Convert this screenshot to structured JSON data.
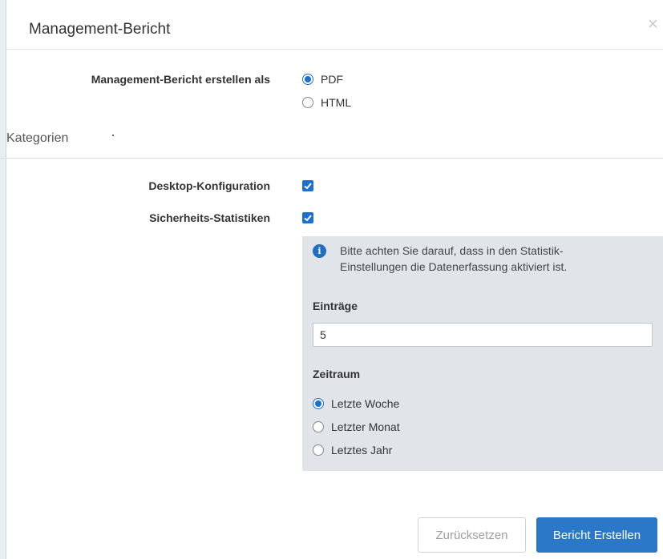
{
  "dialog": {
    "title": "Management-Bericht",
    "close_glyph": "×"
  },
  "format": {
    "label": "Management-Bericht erstellen als",
    "options": [
      {
        "label": "PDF",
        "checked": true
      },
      {
        "label": "HTML",
        "checked": false
      }
    ]
  },
  "categories": {
    "title": "Kategorien",
    "items": [
      {
        "label": "Desktop-Konfiguration",
        "checked": true
      },
      {
        "label": "Sicherheits-Statistiken",
        "checked": true
      }
    ]
  },
  "stats_panel": {
    "info_icon": "info-circle-icon",
    "info_glyph": "i",
    "info_text": "Bitte achten Sie darauf, dass in den Statistik-Einstellungen die Datenerfassung aktiviert ist.",
    "entries_label": "Einträge",
    "entries_value": "5",
    "period_label": "Zeitraum",
    "period_options": [
      {
        "label": "Letzte Woche",
        "checked": true
      },
      {
        "label": "Letzter Monat",
        "checked": false
      },
      {
        "label": "Letztes Jahr",
        "checked": false
      }
    ]
  },
  "footer": {
    "reset_label": "Zurücksetzen",
    "create_label": "Bericht Erstellen"
  },
  "colors": {
    "accent": "#1a6fd1",
    "panel_bg": "#e1e5ea",
    "primary_button": "#2a78c7"
  }
}
